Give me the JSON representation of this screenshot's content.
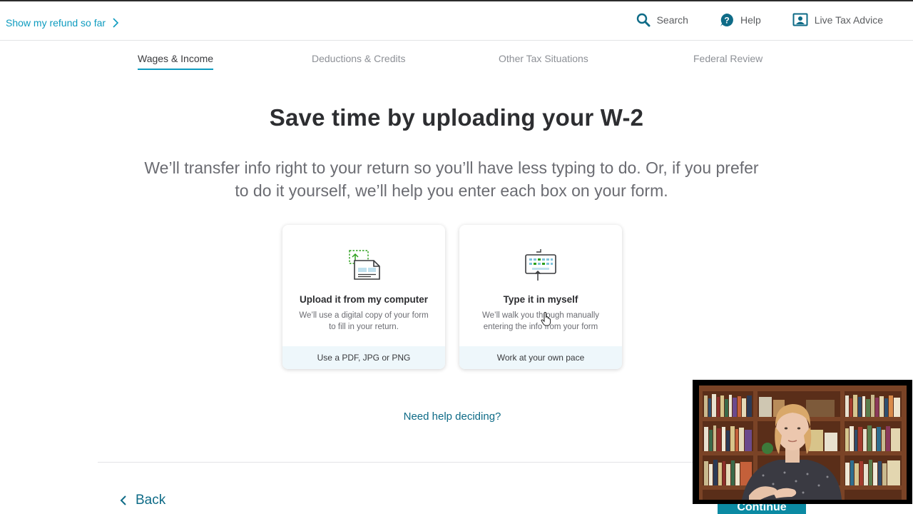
{
  "header": {
    "refund_link": "Show my refund so far",
    "actions": [
      {
        "label": "Search",
        "icon": "search-icon"
      },
      {
        "label": "Help",
        "icon": "help-icon"
      },
      {
        "label": "Live Tax Advice",
        "icon": "live-tax-advice-icon"
      }
    ]
  },
  "tabs": [
    {
      "label": "Wages & Income",
      "active": true
    },
    {
      "label": "Deductions & Credits",
      "active": false
    },
    {
      "label": "Other Tax Situations",
      "active": false
    },
    {
      "label": "Federal Review",
      "active": false
    }
  ],
  "main": {
    "title": "Save time by uploading your W-2",
    "subtitle": "We’ll transfer info right to your return so you’ll have less typing to do. Or, if you prefer to do it yourself, we’ll help you enter each box on your form.",
    "cards": [
      {
        "icon": "upload-document-icon",
        "title": "Upload it from my computer",
        "description": "We’ll use a digital copy of your form to fill in your return.",
        "footer": "Use a PDF, JPG or PNG"
      },
      {
        "icon": "keyboard-icon",
        "title": "Type it in myself",
        "description": "We’ll walk you through manually entering the info from your form",
        "footer": "Work at your own pace"
      }
    ],
    "help_link": "Need help deciding?"
  },
  "footer": {
    "back_label": "Back",
    "continue_label": "Continue"
  },
  "colors": {
    "accent": "#0d9bbf",
    "link_dark": "#0e6b87",
    "continue_bg": "#0b8aa3",
    "card_footer_bg": "#eef7fb"
  }
}
